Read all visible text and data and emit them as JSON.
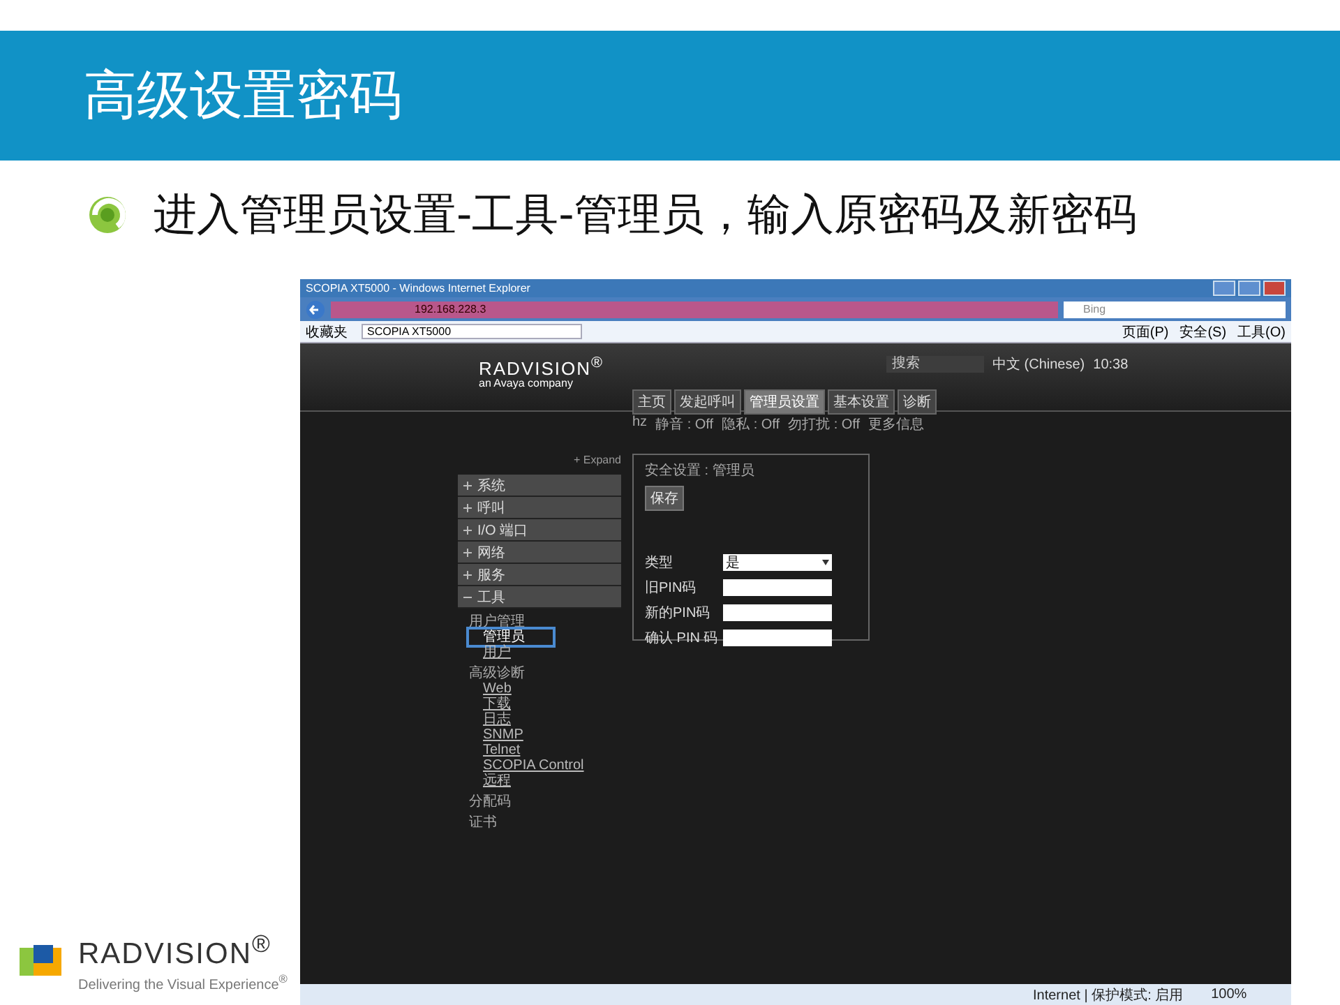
{
  "slide": {
    "title": "高级设置密码",
    "bullet": "进入管理员设置-工具-管理员，输入原密码及新密码",
    "logo": "RADVISION$^{®}$",
    "tagline": "Delivering the Visual Experience$^{®}$"
  },
  "browser": {
    "title": "SCOPIA XT5000 - Windows Internet Explorer",
    "address": "192.168.228.3",
    "search_placeholder": "Bing",
    "favorites": "收藏夹",
    "tab": "SCOPIA XT5000",
    "toolbar": [
      "页面(P)",
      "安全(S)",
      "工具(O)"
    ],
    "status": "Internet | 保护模式: 启用",
    "zoom": "100%"
  },
  "app": {
    "logo": "RADVISION$^{®}$",
    "logo_sub": "an Avaya company",
    "search_value": "搜索",
    "language": "中文 (Chinese)",
    "time": "10:38",
    "tabs": [
      {
        "label": "主页",
        "selected": false
      },
      {
        "label": "发起呼叫",
        "selected": false
      },
      {
        "label": "管理员设置",
        "selected": true
      },
      {
        "label": "基本设置",
        "selected": false
      },
      {
        "label": "诊断",
        "selected": false
      }
    ],
    "status_items": [
      "hz",
      "静音 : Off",
      "隐私 : Off",
      "勿打扰 : Off",
      "更多信息"
    ],
    "expand": "+ Expand",
    "menu": [
      {
        "label": "系统",
        "expanded": false
      },
      {
        "label": "呼叫",
        "expanded": false
      },
      {
        "label": "I/O 端口",
        "expanded": false
      },
      {
        "label": "网络",
        "expanded": false
      },
      {
        "label": "服务",
        "expanded": false
      },
      {
        "label": "工具",
        "expanded": true,
        "children": [
          {
            "label": "用户管理",
            "children": [
              {
                "label": "管理员",
                "selected": true
              },
              {
                "label": "用户",
                "selected": false
              }
            ]
          },
          {
            "label": "高级诊断",
            "children": [
              {
                "label": "Web",
                "selected": false
              },
              {
                "label": "下载",
                "selected": false
              },
              {
                "label": "日志",
                "selected": false
              },
              {
                "label": "SNMP",
                "selected": false
              },
              {
                "label": "Telnet",
                "selected": false
              },
              {
                "label": "SCOPIA Control",
                "selected": false
              },
              {
                "label": "远程",
                "selected": false
              }
            ]
          },
          {
            "label": "分配码"
          },
          {
            "label": "证书"
          }
        ]
      }
    ],
    "panel": {
      "breadcrumb": "安全设置 : 管理员",
      "save": "保存",
      "fields": [
        {
          "label": "类型",
          "kind": "select",
          "value": "是"
        },
        {
          "label": "旧PIN码",
          "kind": "input"
        },
        {
          "label": "新的PIN码",
          "kind": "input"
        },
        {
          "label": "确认 PIN 码",
          "kind": "input"
        }
      ]
    }
  }
}
